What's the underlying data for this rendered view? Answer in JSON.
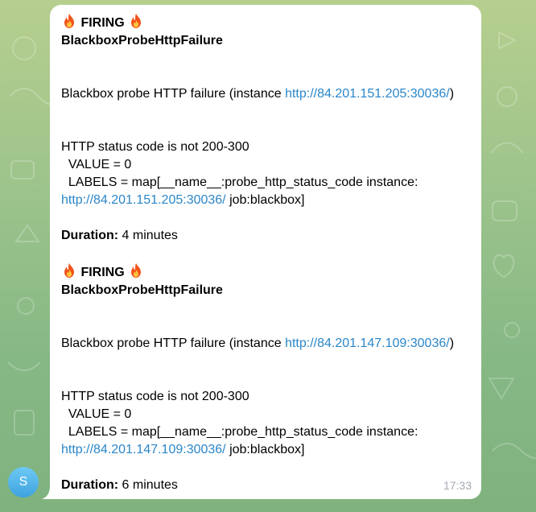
{
  "chat": {
    "avatar_letter": "S",
    "message": {
      "time": "17:33",
      "alerts": [
        {
          "status": "FIRING",
          "name": "BlackboxProbeHttpFailure",
          "summary_prefix": "Blackbox probe HTTP failure (instance ",
          "summary_link": "http://84.201.151.205:30036/",
          "summary_suffix": ")",
          "detail_title": "HTTP status code is not 200-300",
          "value_line": "  VALUE = 0",
          "labels_line": "  LABELS = map[__name__:probe_http_status_code instance:",
          "labels_link": "http://84.201.151.205:30036/",
          "labels_suffix": " job:blackbox]",
          "duration_label": "Duration:",
          "duration_value": " 4 minutes"
        },
        {
          "status": "FIRING",
          "name": "BlackboxProbeHttpFailure",
          "summary_prefix": "Blackbox probe HTTP failure (instance ",
          "summary_link": "http://84.201.147.109:30036/",
          "summary_suffix": ")",
          "detail_title": "HTTP status code is not 200-300",
          "value_line": "  VALUE = 0",
          "labels_line": "  LABELS = map[__name__:probe_http_status_code instance:",
          "labels_link": "http://84.201.147.109:30036/",
          "labels_suffix": " job:blackbox]",
          "duration_label": "Duration:",
          "duration_value": " 6 minutes"
        }
      ]
    },
    "colors": {
      "link": "#2a86c9",
      "timestamp": "#a3aab2",
      "avatar": "#4fb0e6"
    }
  }
}
